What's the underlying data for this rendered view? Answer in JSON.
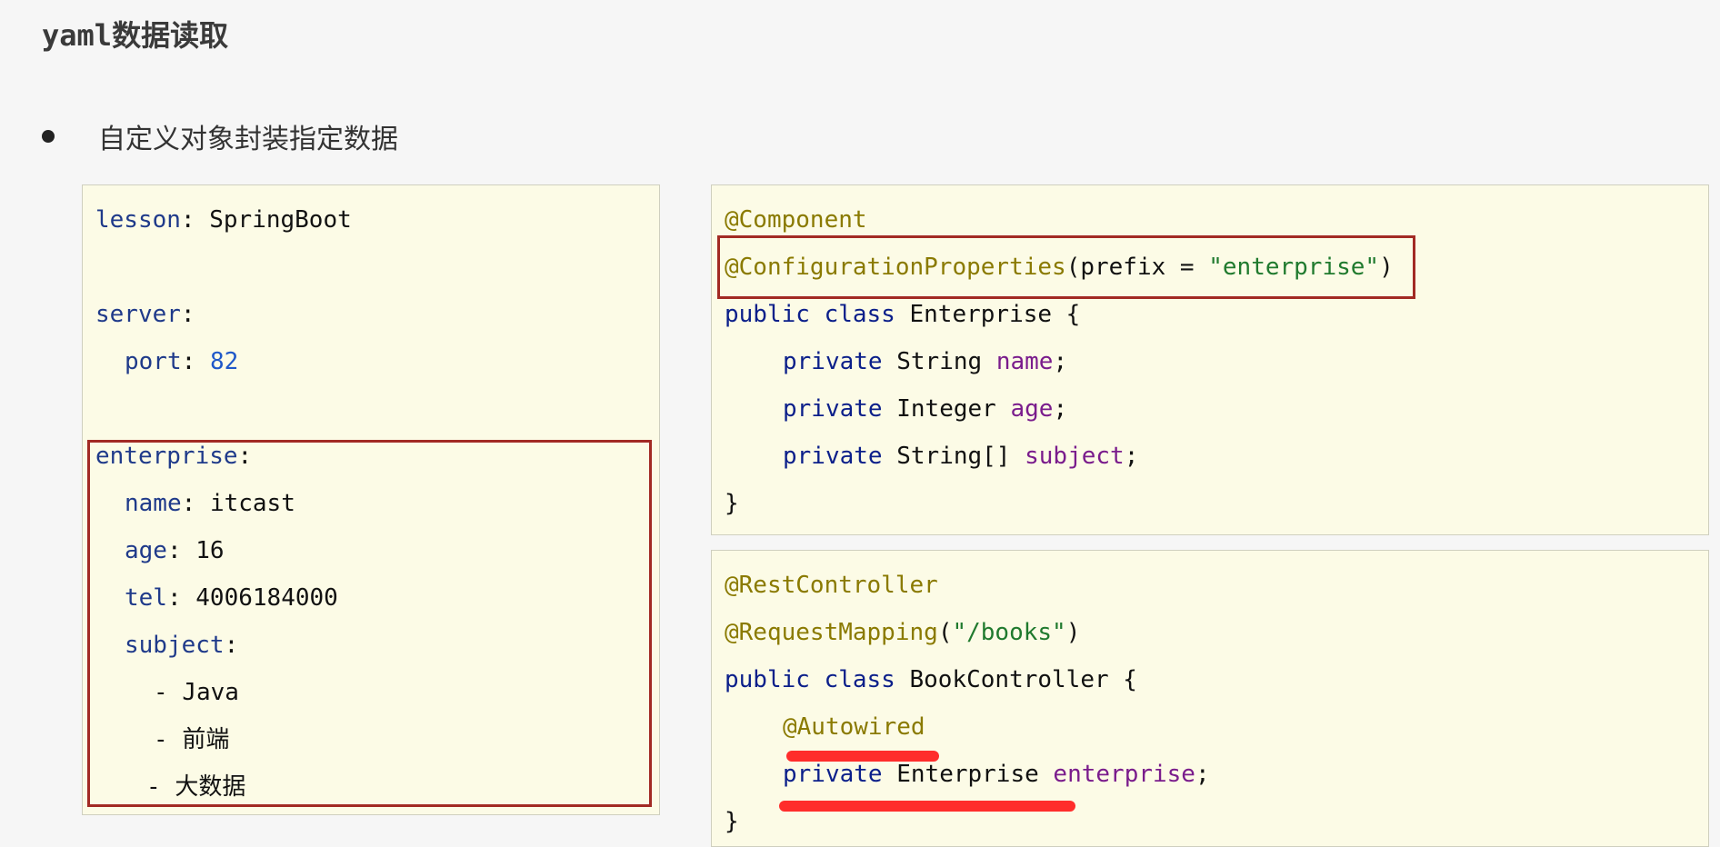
{
  "header": {
    "title": "yaml数据读取"
  },
  "bullet": {
    "text": "自定义对象封装指定数据"
  },
  "yaml_panel": {
    "lines": [
      {
        "key": "lesson",
        "sep": ": ",
        "value": "SpringBoot"
      },
      {
        "key": "server",
        "sep": ":",
        "value": ""
      },
      {
        "key": "port",
        "sep": ": ",
        "value": "82"
      },
      {
        "key": "enterprise",
        "sep": ":",
        "value": ""
      },
      {
        "key": "name",
        "sep": ": ",
        "value": "itcast"
      },
      {
        "key": "age",
        "sep": ": ",
        "value": "16"
      },
      {
        "key": "tel",
        "sep": ": ",
        "value": "4006184000"
      },
      {
        "key": "subject",
        "sep": ":",
        "value": ""
      },
      {
        "dash": "- ",
        "value": "Java"
      },
      {
        "dash": "- ",
        "value": "前端"
      },
      {
        "dash": "- ",
        "value": "大数据"
      }
    ]
  },
  "enterprise_panel": {
    "annotation1": "@Component",
    "annotation2": "@ConfigurationProperties",
    "prefix_open": "(prefix = ",
    "prefix_value": "\"enterprise\"",
    "prefix_close": ")",
    "class_kw": "public class ",
    "class_name": "Enterprise {",
    "private_kw": "private ",
    "fields": [
      {
        "type": "String ",
        "name": "name",
        "end": ";"
      },
      {
        "type": "Integer ",
        "name": "age",
        "end": ";"
      },
      {
        "type": "String[] ",
        "name": "subject",
        "end": ";"
      }
    ],
    "close": "}"
  },
  "controller_panel": {
    "annotation1": "@RestController",
    "annotation2": "@RequestMapping",
    "mapping_open": "(",
    "mapping_value": "\"/books\"",
    "mapping_close": ")",
    "class_kw": "public class ",
    "class_name": "BookController {",
    "autowired": "@Autowired",
    "private_kw": "private ",
    "field_type": "Enterprise ",
    "field_name": "enterprise",
    "field_end": ";",
    "close": "}"
  },
  "colors": {
    "panel_bg": "#fcfbe6",
    "highlight_border": "#a22a24",
    "scribble": "#ff1b1b",
    "annotation": "#8a7a00",
    "keyword": "#0b1f8a",
    "field": "#7a1c8c",
    "string": "#207a2e"
  }
}
